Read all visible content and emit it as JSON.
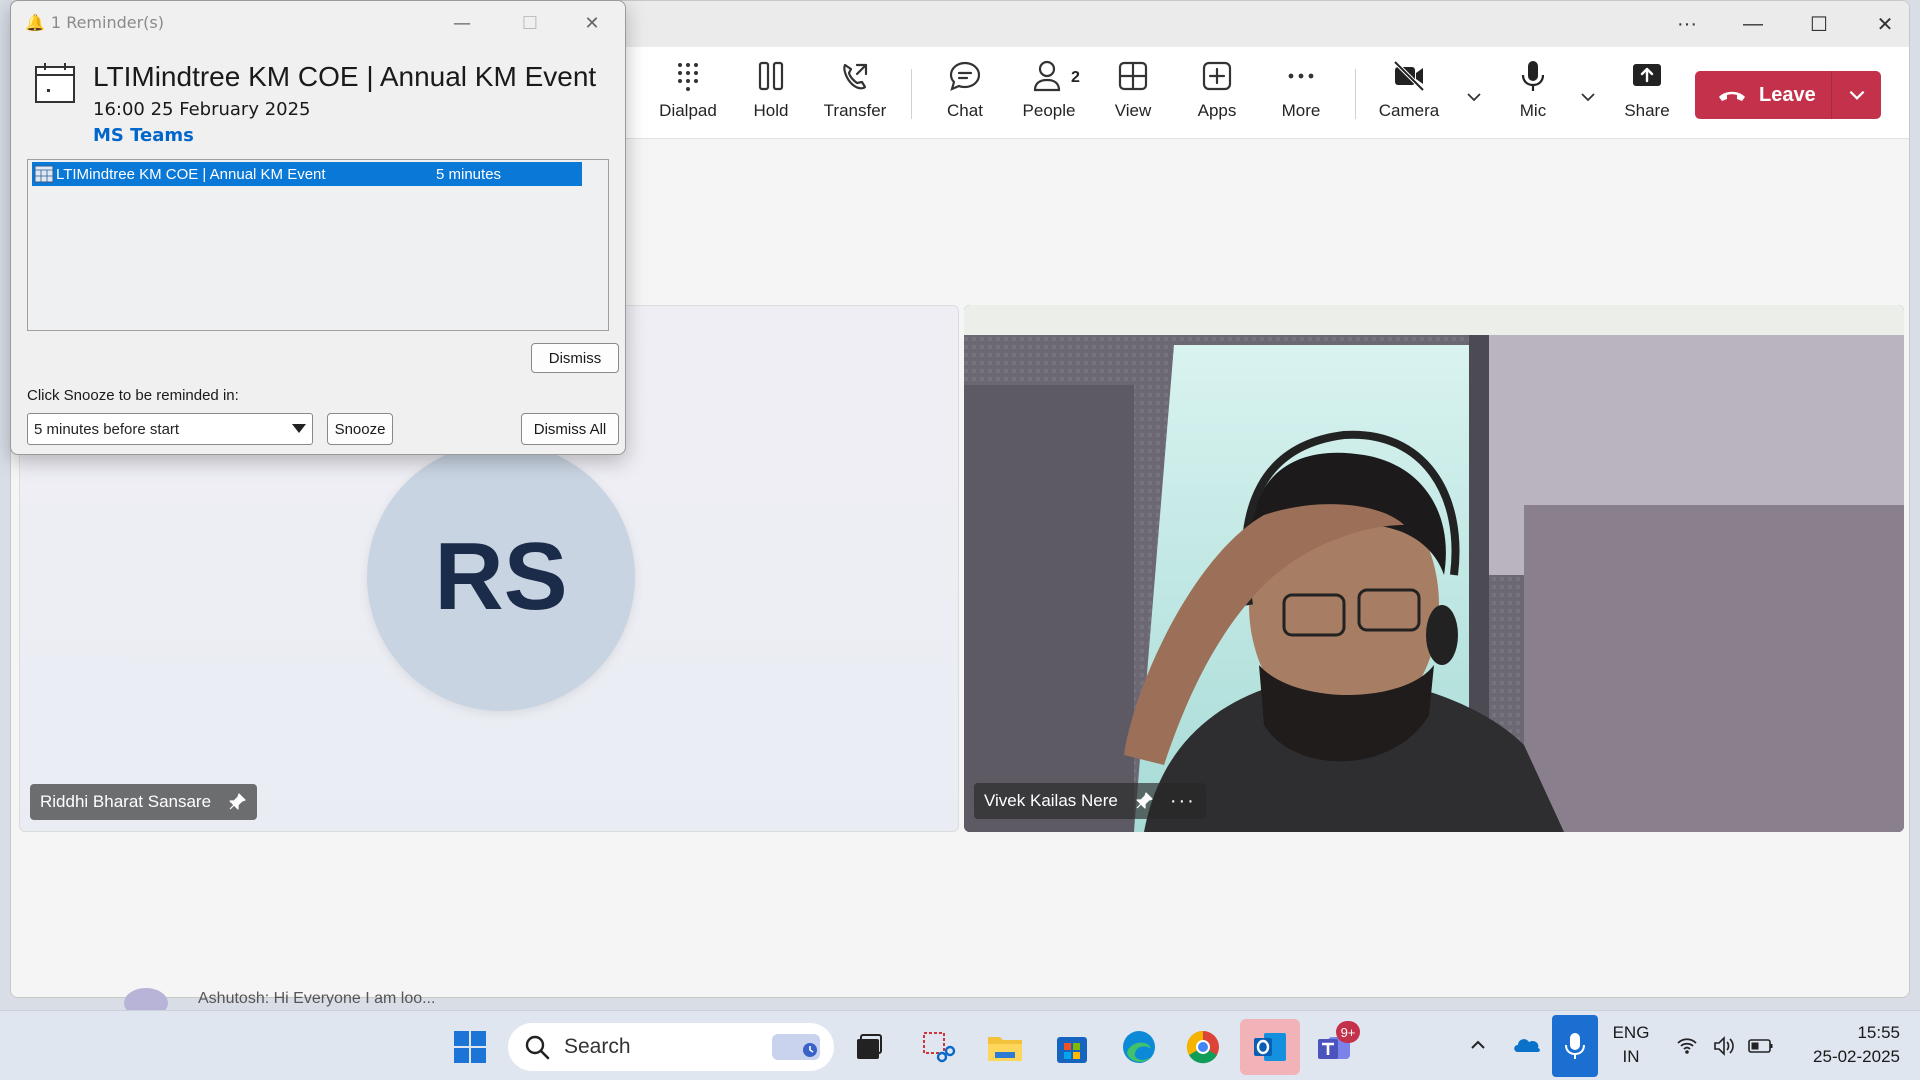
{
  "reminder": {
    "window_title": "1 Reminder(s)",
    "subject": "LTIMindtree KM COE | Annual KM Event",
    "time": "16:00 25 February 2025",
    "location": "MS Teams",
    "list_row": {
      "subject": "LTIMindtree KM COE | Annual KM Event",
      "due_in": "5 minutes"
    },
    "dismiss_label": "Dismiss",
    "snooze_hint": "Click Snooze to be reminded in:",
    "snooze_option": "5 minutes before start",
    "snooze_label": "Snooze",
    "dismiss_all_label": "Dismiss All"
  },
  "toolbar": {
    "dialpad": "Dialpad",
    "hold": "Hold",
    "transfer": "Transfer",
    "chat": "Chat",
    "people": "People",
    "people_count": "2",
    "view": "View",
    "apps": "Apps",
    "more": "More",
    "camera": "Camera",
    "mic": "Mic",
    "share": "Share",
    "leave": "Leave"
  },
  "participants": [
    {
      "initials": "RS",
      "name": "Riddhi Bharat Sansare"
    },
    {
      "name": "Vivek Kailas Nere"
    }
  ],
  "chat_preview": "Ashutosh: Hi Everyone   I am loo...",
  "taskbar": {
    "search_placeholder": "Search",
    "teams_badge": "9+",
    "lang_line1": "ENG",
    "lang_line2": "IN",
    "time": "15:55",
    "date": "25-02-2025"
  },
  "colors": {
    "leave_red": "#c4314b",
    "selection_blue": "#0a78d7",
    "location_blue": "#0066cc"
  }
}
